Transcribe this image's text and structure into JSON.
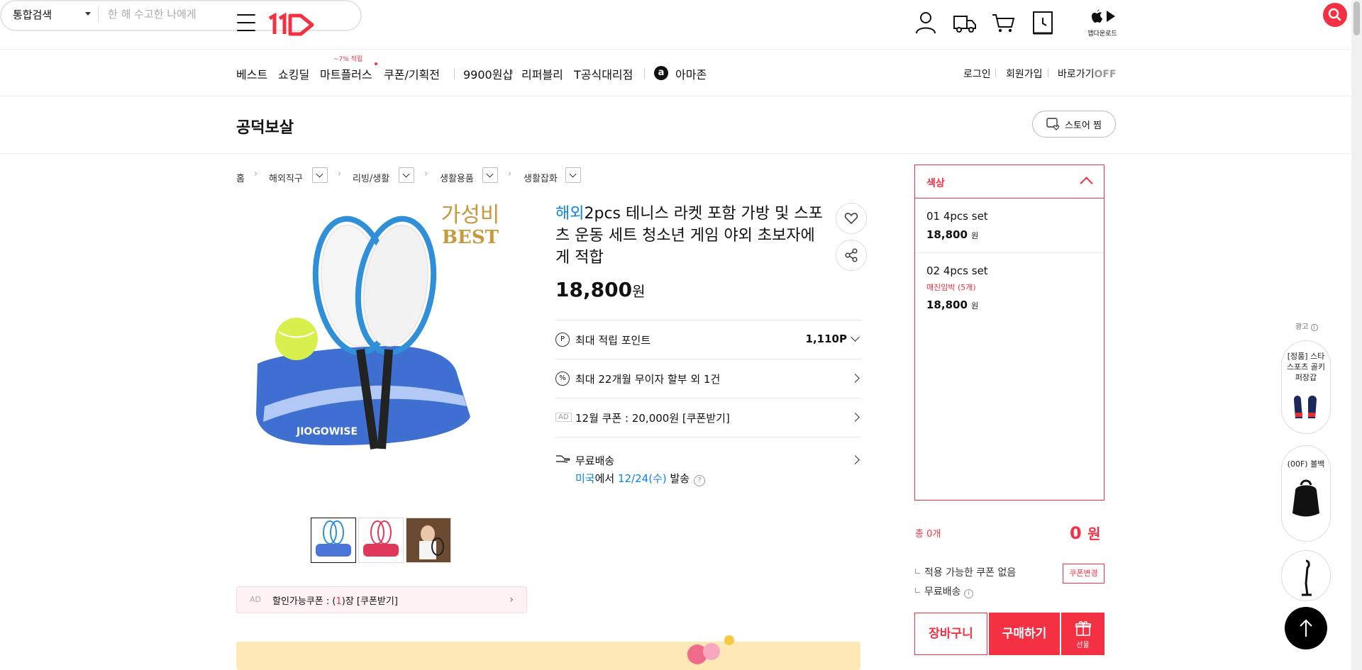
{
  "header": {
    "search_scope": "통합검색",
    "search_placeholder": "한 해 수고한 나에게",
    "app_download": "앱다운로드"
  },
  "nav": {
    "items": [
      "베스트",
      "쇼킹딜",
      "마트플러스",
      "쿠폰/기획전",
      "9900원샵",
      "리퍼블리",
      "T공식대리점",
      "아마존"
    ],
    "mart_badge": "~7% 적립",
    "login": "로그인",
    "signup": "회원가입",
    "shortcut": "바로가기",
    "shortcut_state": "OFF"
  },
  "store": {
    "name": "공덕보살",
    "fav_label": "스토어 찜"
  },
  "breadcrumb": [
    "홈",
    "해외직구",
    "리빙/생활",
    "생활용품",
    "생활잡화"
  ],
  "product": {
    "image_badge_1": "가성비",
    "image_badge_2": "BEST",
    "bag_brand": "JIOGOWISE",
    "tag": "해외",
    "title": "2pcs 테니스 라켓 포함 가방 및 스포츠 운동 세트 청소년 게임 야외 초보자에게 적합",
    "price": "18,800",
    "price_unit": "원",
    "points_label": "최대 적립 포인트",
    "points_value": "1,110P",
    "installment": "최대 22개월 무이자 할부 외 1건",
    "ad_tag": "AD",
    "coupon_line": "12월 쿠폰 : 20,000원 [쿠폰받기]",
    "shipping_label": "무료배송",
    "ship_origin": "미국",
    "ship_mid": "에서 ",
    "ship_date": "12/24(수)",
    "ship_end": " 발송",
    "coupon_ad_tag": "AD",
    "coupon_ad_pre": "할인가능쿠폰 : (",
    "coupon_ad_count": "1",
    "coupon_ad_post": ")장 [쿠폰받기]"
  },
  "options": {
    "header": "색상",
    "items": [
      {
        "name": "01 4pcs set",
        "note": "",
        "price": "18,800",
        "unit": "원"
      },
      {
        "name": "02 4pcs set",
        "note": "매진임박 (5개)",
        "price": "18,800",
        "unit": "원"
      }
    ]
  },
  "order": {
    "total_label": "총 0개",
    "total_amount": "0",
    "total_unit": "원",
    "no_coupon": "적용 가능한 쿠폰 없음",
    "free_ship": "무료배송",
    "coupon_change": "쿠폰변경",
    "cart": "장바구니",
    "buy": "구매하기",
    "gift": "선물"
  },
  "side_ads": {
    "label": "광고",
    "items": [
      "[정품] 스타스포츠 골키퍼장갑",
      "(00F) 볼백"
    ]
  },
  "colors": {
    "accent": "#f43142",
    "link": "#0b83e6"
  }
}
